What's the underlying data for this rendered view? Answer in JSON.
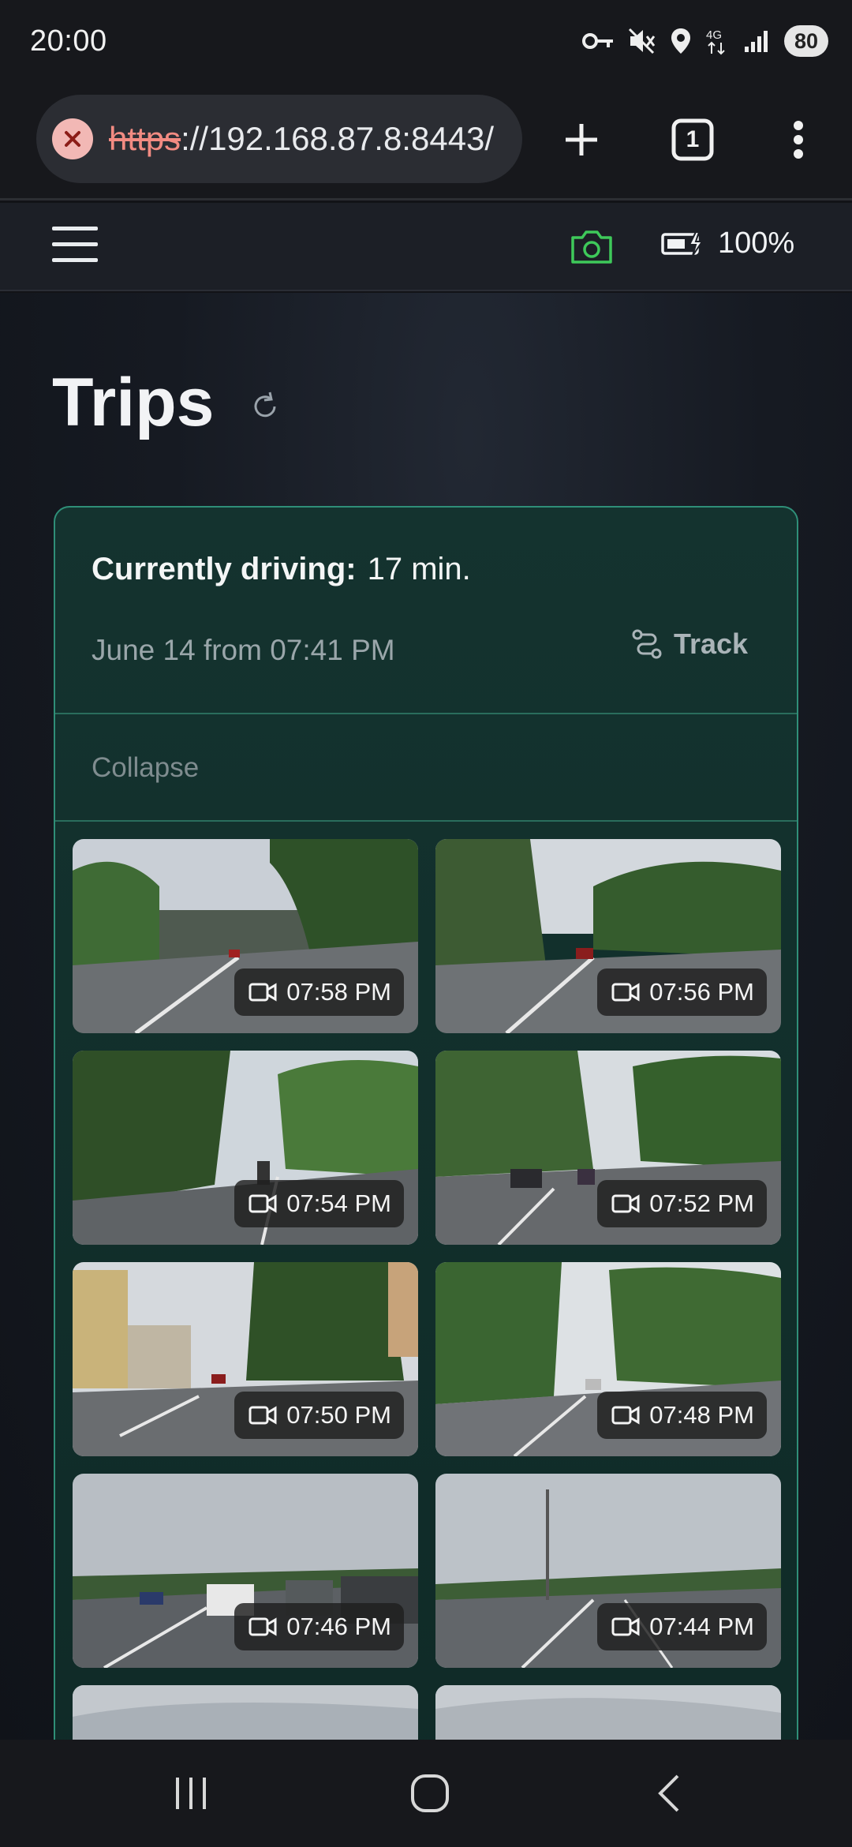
{
  "status_bar": {
    "time": "20:00",
    "battery_level": "80",
    "network": "4G",
    "icons": [
      "vpn-key-icon",
      "mute-icon",
      "location-icon",
      "network-4g-icon",
      "signal-icon",
      "battery-icon"
    ]
  },
  "browser": {
    "url_scheme": "https",
    "url_rest": "://192.168.87.8:8443/",
    "tab_count": "1",
    "icons": [
      "insecure-icon",
      "new-tab-icon",
      "tab-switcher-icon",
      "more-menu-icon"
    ]
  },
  "app_header": {
    "battery_percent": "100%",
    "accent_color": "#3ec95a"
  },
  "page": {
    "title": "Trips"
  },
  "trip": {
    "driving_label": "Currently driving:",
    "driving_value": "17 min.",
    "date_text": "June 14 from 07:41 PM",
    "track_label": "Track",
    "collapse_label": "Collapse",
    "clips": [
      {
        "time": "07:58 PM"
      },
      {
        "time": "07:56 PM"
      },
      {
        "time": "07:54 PM"
      },
      {
        "time": "07:52 PM"
      },
      {
        "time": "07:50 PM"
      },
      {
        "time": "07:48 PM"
      },
      {
        "time": "07:46 PM"
      },
      {
        "time": "07:44 PM"
      },
      {
        "time": ""
      },
      {
        "time": ""
      }
    ]
  },
  "colors": {
    "card_border": "#2f8f78",
    "card_bg": "#14332f",
    "insecure": "#f28b82"
  }
}
